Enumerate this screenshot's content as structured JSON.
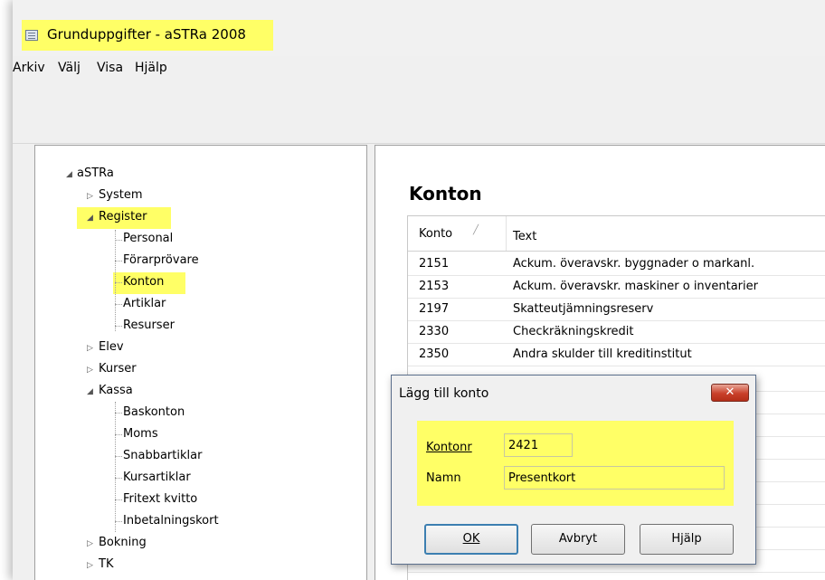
{
  "window": {
    "title": "Grunduppgifter - aSTRa 2008",
    "highlight_color": "#ffff66"
  },
  "menubar": {
    "items": [
      {
        "label": "Arkiv"
      },
      {
        "label": "Välj"
      },
      {
        "label": "Visa"
      },
      {
        "label": "Hjälp"
      }
    ]
  },
  "tree": {
    "root": "aSTRa",
    "nodes": {
      "system": "System",
      "register": "Register",
      "personal": "Personal",
      "forarprovare": "Förarprövare",
      "konton": "Konton",
      "artiklar": "Artiklar",
      "resurser": "Resurser",
      "elev": "Elev",
      "kurser": "Kurser",
      "kassa": "Kassa",
      "baskonton": "Baskonton",
      "moms": "Moms",
      "snabbartiklar": "Snabbartiklar",
      "kursartiklar": "Kursartiklar",
      "fritext": "Fritext kvitto",
      "inbetalningskort": "Inbetalningskort",
      "bokning": "Bokning",
      "tk": "TK"
    }
  },
  "main": {
    "heading": "Konton",
    "columns": {
      "konto": "Konto",
      "text": "Text"
    },
    "rows": [
      {
        "konto": "2151",
        "text": "Ackum. överavskr. byggnader o markanl."
      },
      {
        "konto": "2153",
        "text": "Ackum. överavskr. maskiner o inventarier"
      },
      {
        "konto": "2197",
        "text": "Skatteutjämningsreserv"
      },
      {
        "konto": "2330",
        "text": "Checkräkningskredit"
      },
      {
        "konto": "2350",
        "text": "Andra skulder till kreditinstitut"
      }
    ]
  },
  "dialog": {
    "title": "Lägg till konto",
    "close_glyph": "✕",
    "kontonr_label": "Kontonr",
    "kontonr_value": "2421",
    "namn_label": "Namn",
    "namn_value": "Presentkort",
    "ok_label": "OK",
    "cancel_label": "Avbryt",
    "help_label": "Hjälp"
  }
}
